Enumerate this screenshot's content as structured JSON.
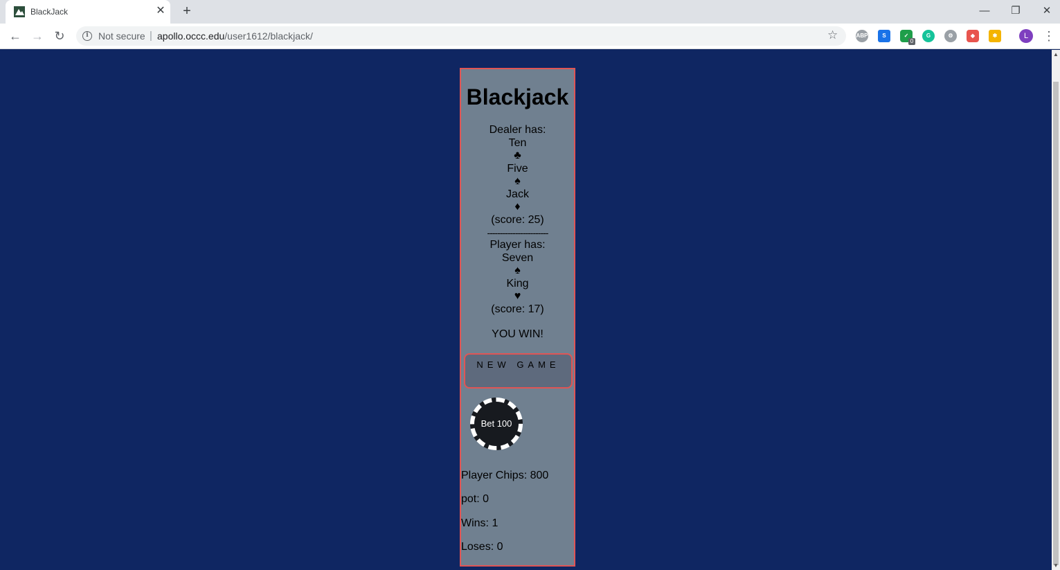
{
  "browser": {
    "tab_title": "BlackJack",
    "security_label": "Not secure",
    "url_host": "apollo.occc.edu",
    "url_path": "/user1612/blackjack/",
    "profile_initial": "L",
    "extension_badge": "0"
  },
  "game": {
    "title": "Blackjack",
    "dealer": {
      "label": "Dealer has:",
      "cards": [
        {
          "rank": "Ten",
          "suit": "♣"
        },
        {
          "rank": "Five",
          "suit": "♠"
        },
        {
          "rank": "Jack",
          "suit": "♦"
        }
      ],
      "score": "(score: 25)"
    },
    "divider": "------------------------",
    "player": {
      "label": "Player has:",
      "cards": [
        {
          "rank": "Seven",
          "suit": "♠"
        },
        {
          "rank": "King",
          "suit": "♥"
        }
      ],
      "score": "(score: 17)"
    },
    "result": "YOU WIN!",
    "new_game_label": "NEW GAME",
    "bet_chip_label": "Bet 100",
    "stats": {
      "chips": "Player Chips: 800",
      "pot": "pot: 0",
      "wins": "Wins: 1",
      "loses": "Loses: 0"
    }
  },
  "colors": {
    "page_background": "#0f2662",
    "panel_background": "#708090",
    "panel_border": "#e05555",
    "chip_background": "#171a1f"
  }
}
